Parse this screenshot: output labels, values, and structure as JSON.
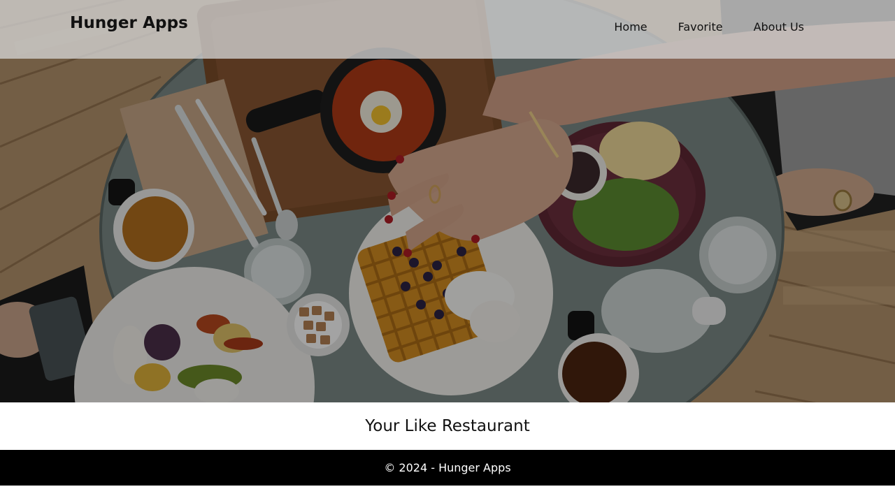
{
  "header": {
    "brand": "Hunger Apps",
    "nav": [
      {
        "label": "Home"
      },
      {
        "label": "Favorite"
      },
      {
        "label": "About Us"
      }
    ]
  },
  "main": {
    "heading": "Your Like Restaurant"
  },
  "footer": {
    "copyright": "© 2024 - Hunger Apps"
  },
  "colors": {
    "footer_bg": "#000000",
    "header_bg": "#d2d2d2",
    "text": "#111111"
  }
}
